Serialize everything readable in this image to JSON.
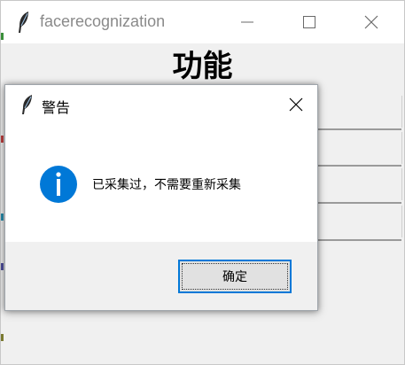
{
  "main_window": {
    "title": "facerecognization",
    "heading": "功能"
  },
  "dialog": {
    "title": "警告",
    "message": "已采集过，不需要重新采集",
    "ok_label": "确定"
  },
  "colors": {
    "accent": "#0078d7",
    "info_icon": "#0078d7",
    "title_text": "#8a8a8a",
    "window_bg": "#f0f0f0"
  },
  "icons": {
    "app": "feather-icon",
    "minimize": "minimize-icon",
    "maximize": "maximize-icon",
    "close": "close-icon",
    "info": "info-icon"
  }
}
